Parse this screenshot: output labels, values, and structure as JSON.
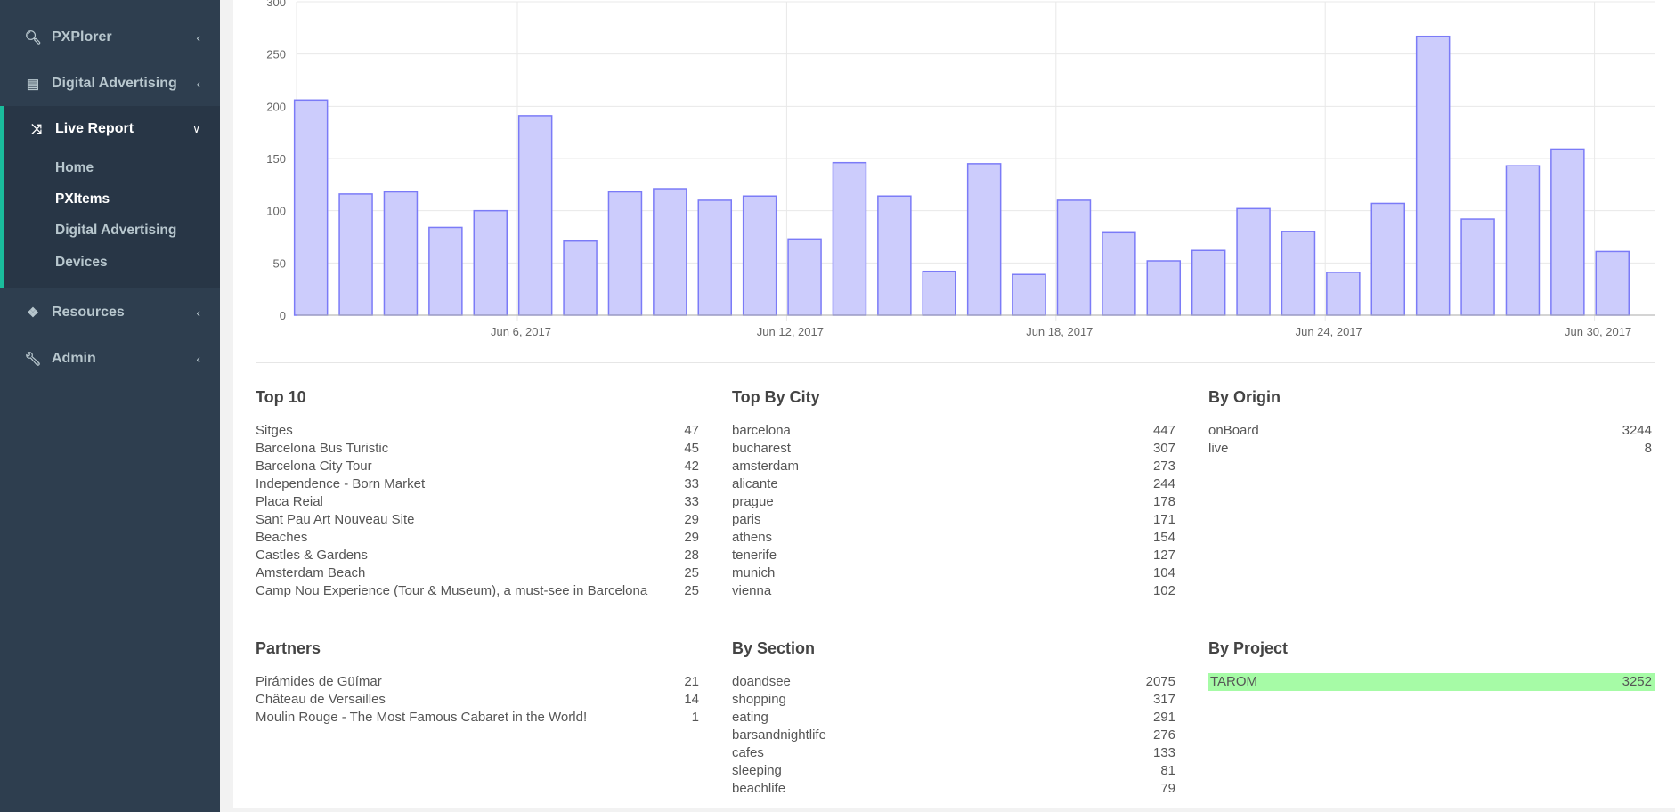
{
  "sidebar": {
    "items": [
      {
        "label": "PXPlorer",
        "icon": "search-icon"
      },
      {
        "label": "Digital Advertising",
        "icon": "newspaper-icon"
      },
      {
        "label": "Live Report",
        "icon": "shuffle-icon",
        "expanded": true,
        "children": [
          {
            "label": "Home"
          },
          {
            "label": "PXItems",
            "active": true
          },
          {
            "label": "Digital Advertising"
          },
          {
            "label": "Devices"
          }
        ]
      },
      {
        "label": "Resources",
        "icon": "cubes-icon"
      },
      {
        "label": "Admin",
        "icon": "wrench-icon"
      }
    ],
    "accent": "#1abc9c"
  },
  "chart_data": {
    "type": "bar",
    "x": [
      "2017-06-01",
      "2017-06-02",
      "2017-06-03",
      "2017-06-04",
      "2017-06-05",
      "2017-06-06",
      "2017-06-07",
      "2017-06-08",
      "2017-06-09",
      "2017-06-10",
      "2017-06-11",
      "2017-06-12",
      "2017-06-13",
      "2017-06-14",
      "2017-06-15",
      "2017-06-16",
      "2017-06-17",
      "2017-06-18",
      "2017-06-19",
      "2017-06-20",
      "2017-06-21",
      "2017-06-22",
      "2017-06-23",
      "2017-06-24",
      "2017-06-25",
      "2017-06-26",
      "2017-06-27",
      "2017-06-28",
      "2017-06-29",
      "2017-06-30"
    ],
    "values": [
      206,
      116,
      118,
      84,
      100,
      191,
      71,
      118,
      121,
      110,
      114,
      73,
      146,
      114,
      42,
      145,
      39,
      110,
      79,
      52,
      62,
      102,
      80,
      41,
      107,
      267,
      92,
      143,
      159,
      61
    ],
    "ylim": [
      0,
      300
    ],
    "yticks": [
      "0",
      "50",
      "100",
      "150",
      "200",
      "250",
      "300"
    ],
    "xticks": [
      "Jun 6, 2017",
      "Jun 12, 2017",
      "Jun 18, 2017",
      "Jun 24, 2017",
      "Jun 30, 2017"
    ],
    "grid": true,
    "bar_color": "#ccccfc",
    "bar_border": "#7b7bf7"
  },
  "panels": [
    {
      "title": "Top 10",
      "rows": [
        [
          "Sitges",
          "47"
        ],
        [
          "Barcelona Bus Turistic",
          "45"
        ],
        [
          "Barcelona City Tour",
          "42"
        ],
        [
          "Independence - Born Market",
          "33"
        ],
        [
          "Placa Reial",
          "33"
        ],
        [
          "Sant Pau Art Nouveau Site",
          "29"
        ],
        [
          "Beaches",
          "29"
        ],
        [
          "Castles & Gardens",
          "28"
        ],
        [
          "Amsterdam Beach",
          "25"
        ],
        [
          "Camp Nou Experience (Tour & Museum), a must-see in Barcelona",
          "25"
        ]
      ]
    },
    {
      "title": "Top By City",
      "rows": [
        [
          "barcelona",
          "447"
        ],
        [
          "bucharest",
          "307"
        ],
        [
          "amsterdam",
          "273"
        ],
        [
          "alicante",
          "244"
        ],
        [
          "prague",
          "178"
        ],
        [
          "paris",
          "171"
        ],
        [
          "athens",
          "154"
        ],
        [
          "tenerife",
          "127"
        ],
        [
          "munich",
          "104"
        ],
        [
          "vienna",
          "102"
        ]
      ]
    },
    {
      "title": "By Origin",
      "rows": [
        [
          "onBoard",
          "3244"
        ],
        [
          "live",
          "8"
        ]
      ]
    },
    {
      "title": "Partners",
      "rows": [
        [
          "Pirámides de Güímar",
          "21"
        ],
        [
          "Château de Versailles",
          "14"
        ],
        [
          "Moulin Rouge - The Most Famous Cabaret in the World!",
          "1"
        ]
      ]
    },
    {
      "title": "By Section",
      "rows": [
        [
          "doandsee",
          "2075"
        ],
        [
          "shopping",
          "317"
        ],
        [
          "eating",
          "291"
        ],
        [
          "barsandnightlife",
          "276"
        ],
        [
          "cafes",
          "133"
        ],
        [
          "sleeping",
          "81"
        ],
        [
          "beachlife",
          "79"
        ]
      ]
    },
    {
      "title": "By Project",
      "rows": [
        [
          "TAROM",
          "3252"
        ]
      ],
      "highlight": "#a6fba6"
    }
  ]
}
